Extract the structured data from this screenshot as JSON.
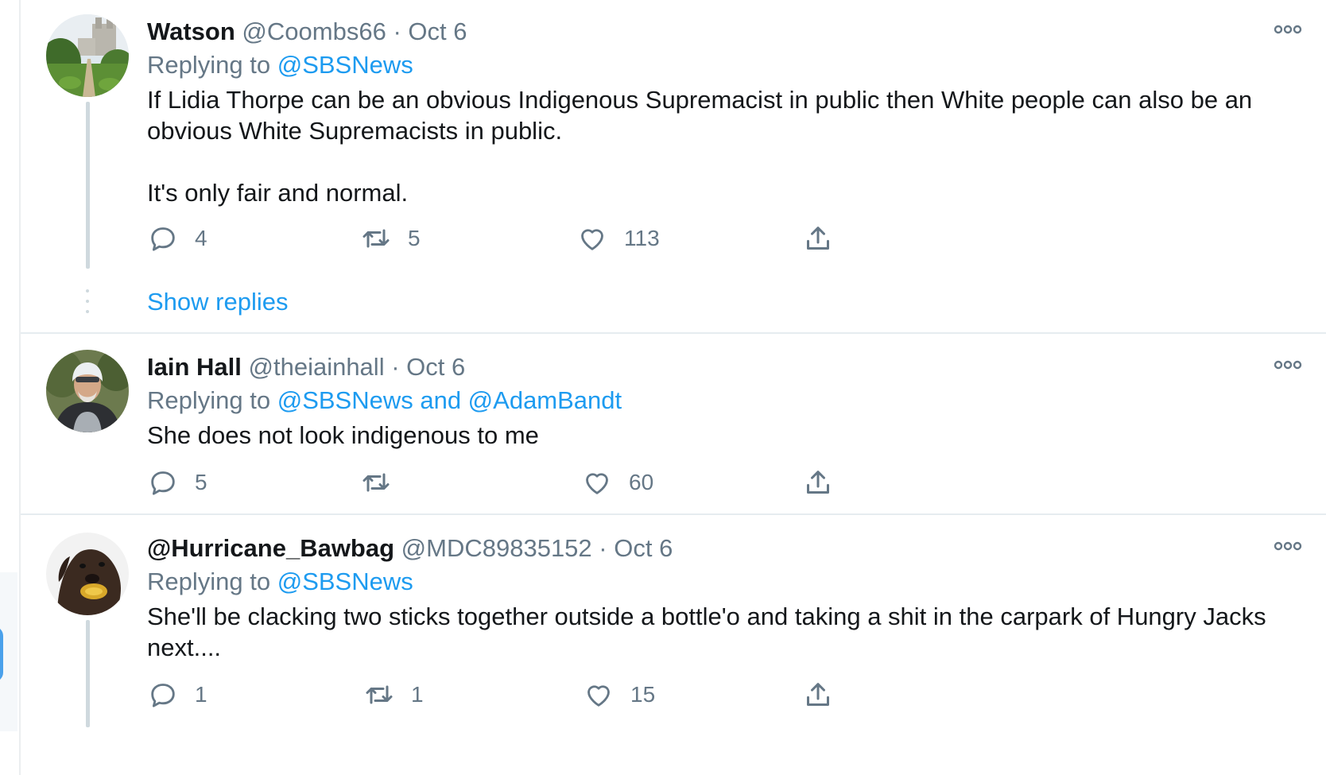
{
  "tweets": [
    {
      "name": "Watson",
      "handle": "@Coombs66",
      "sep": "·",
      "date": "Oct 6",
      "replying_prefix": "Replying to ",
      "replying_to": "@SBSNews",
      "text_lines": [
        "If Lidia Thorpe can be an obvious Indigenous Supremacist in public then White people can also be an obvious White Supremacists in public.",
        "It's only fair and normal."
      ],
      "replies": "4",
      "retweets": "5",
      "likes": "113",
      "show_replies": "Show replies",
      "avatar_icon": "castle-garden-avatar"
    },
    {
      "name": "Iain Hall",
      "handle": "@theiainhall",
      "sep": "·",
      "date": "Oct 6",
      "replying_prefix": "Replying to ",
      "replying_to": "@SBSNews and @AdamBandt",
      "text_lines": [
        "She does not look indigenous to me"
      ],
      "replies": "5",
      "retweets": "",
      "likes": "60",
      "avatar_icon": "motorcyclist-avatar"
    },
    {
      "name": "@Hurricane_Bawbag",
      "handle": "@MDC89835152",
      "sep": "·",
      "date": "Oct 6",
      "replying_prefix": "Replying to ",
      "replying_to": "@SBSNews",
      "text_lines": [
        "She'll be clacking two sticks together outside a bottle'o and taking a shit in the carpark of Hungry Jacks next...."
      ],
      "replies": "1",
      "retweets": "1",
      "likes": "15",
      "avatar_icon": "dog-avatar"
    }
  ],
  "colors": {
    "accent": "#1d9bf0",
    "secondary": "#657786",
    "text": "#14171a",
    "line": "#cfd9de"
  },
  "icons": [
    "reply-icon",
    "retweet-icon",
    "like-icon",
    "share-icon",
    "more-options-icon"
  ]
}
